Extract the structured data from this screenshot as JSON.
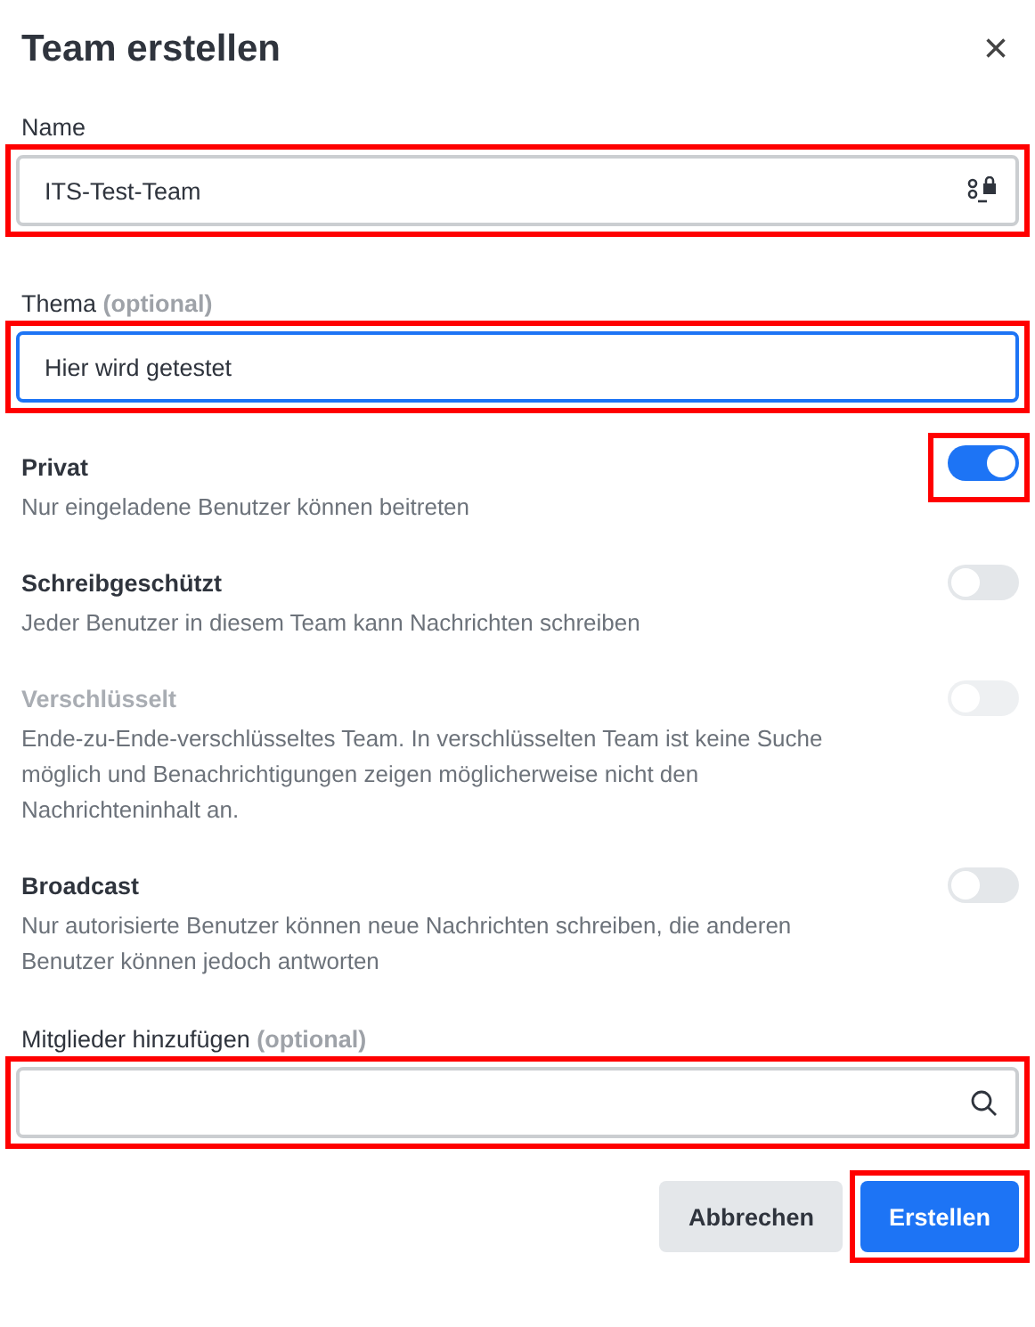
{
  "dialog": {
    "title": "Team erstellen",
    "close": "×"
  },
  "fields": [
    {
      "label": "Name",
      "value": "ITS-Test-Team",
      "focused": false,
      "highlighted": true
    },
    {
      "label": "Thema",
      "optional": "(optional)",
      "value": "Hier wird getestet",
      "focused": true,
      "highlighted": true
    }
  ],
  "options": [
    {
      "title": "Privat",
      "description": "Nur eingeladene Benutzer können beitreten",
      "on": true,
      "disabled": false,
      "highlighted": true
    },
    {
      "title": "Schreibgeschützt",
      "description": "Jeder Benutzer in diesem Team kann Nachrichten schreiben",
      "on": false,
      "disabled": false,
      "highlighted": false
    },
    {
      "title": "Verschlüsselt",
      "description": "Ende-zu-Ende-verschlüsseltes Team. In verschlüsselten Team ist keine Suche möglich und Benachrichtigungen zeigen möglicherweise nicht den Nachrichteninhalt an.",
      "on": false,
      "disabled": true,
      "highlighted": false
    },
    {
      "title": "Broadcast",
      "description": "Nur autorisierte Benutzer können neue Nachrichten schreiben, die anderen Benutzer können jedoch antworten",
      "on": false,
      "disabled": false,
      "highlighted": false
    }
  ],
  "members": {
    "label": "Mitglieder hinzufügen",
    "optional": "(optional)",
    "highlighted": true
  },
  "buttons": [
    {
      "label": "Abbrechen",
      "kind": "secondary",
      "highlighted": false
    },
    {
      "label": "Erstellen",
      "kind": "primary",
      "highlighted": true
    }
  ]
}
